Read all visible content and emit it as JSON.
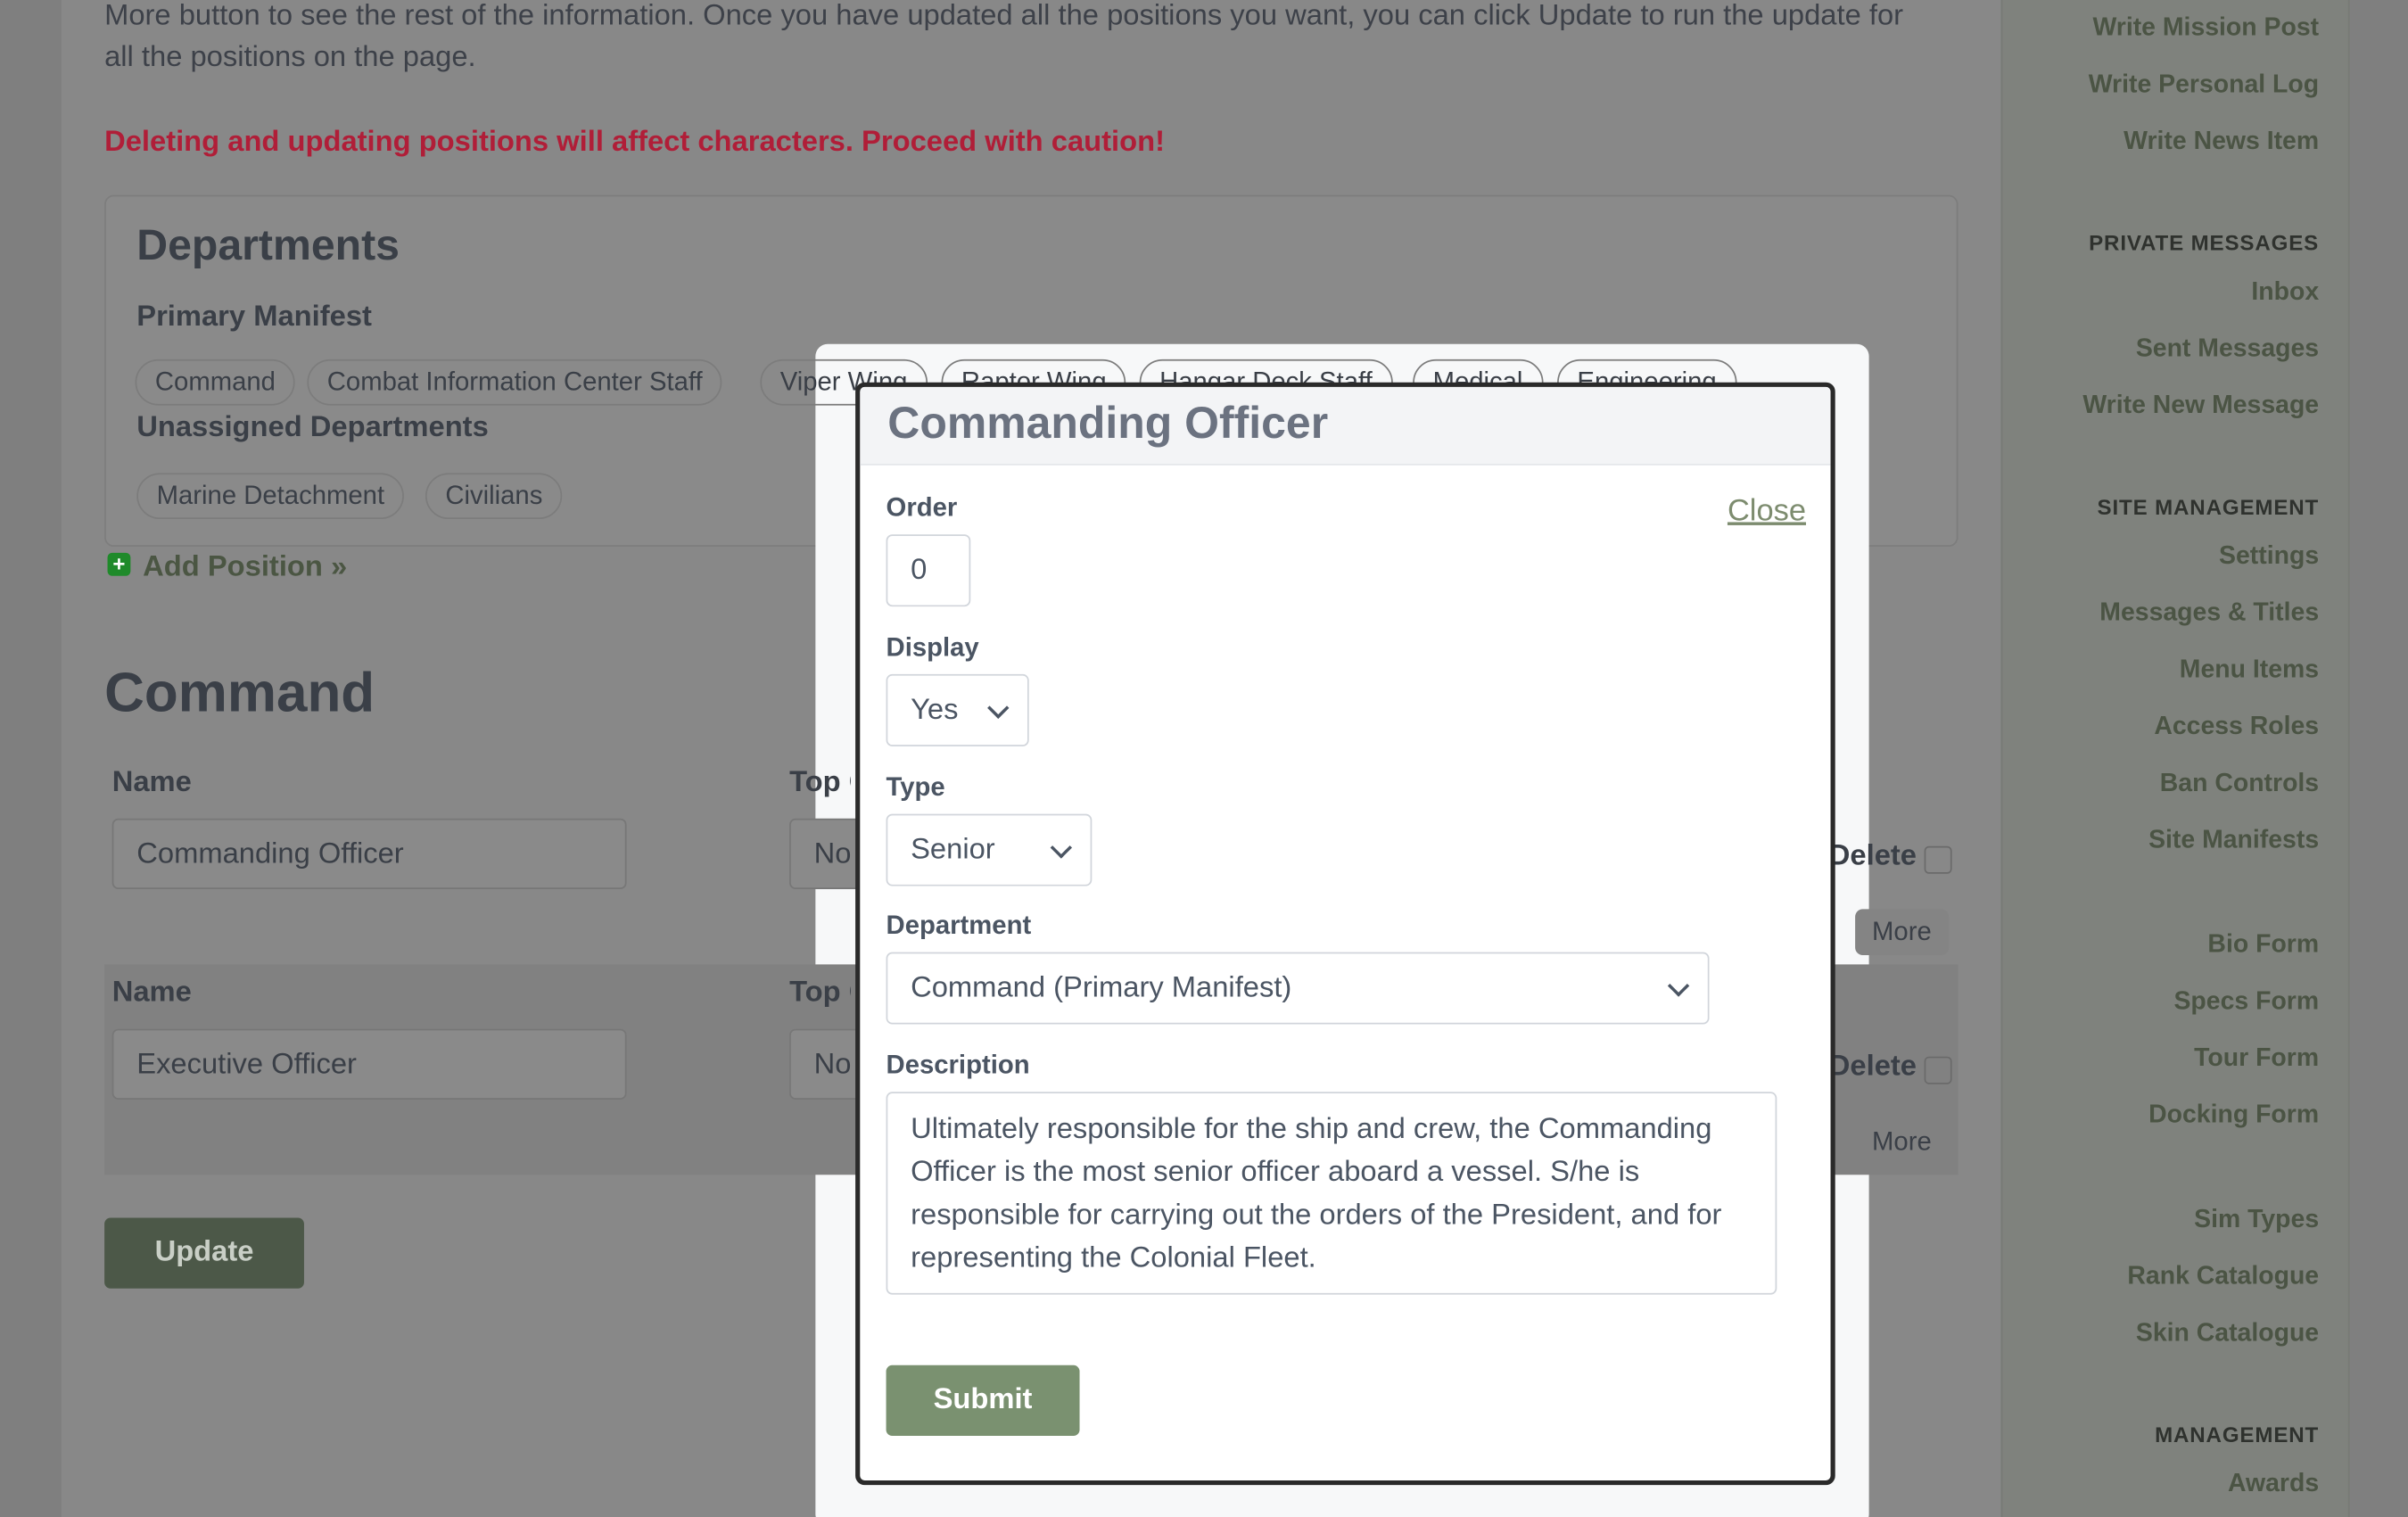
{
  "intro": "More button to see the rest of the information. Once you have updated all the positions you want, you can click Update to run the update for all the positions on the page.",
  "warning": "Deleting and updating positions will affect characters. Proceed with caution!",
  "departments": {
    "title": "Departments",
    "primary_label": "Primary Manifest",
    "primary": [
      "Command",
      "Combat Information Center Staff",
      "Viper Wing",
      "Raptor Wing",
      "Hangar Deck Staff",
      "Medical",
      "Engineering"
    ],
    "unassigned_label": "Unassigned Departments",
    "unassigned": [
      "Marine Detachment",
      "Civilians"
    ]
  },
  "add_position": "Add Position »",
  "section_title": "Command",
  "positions": [
    {
      "name_label": "Name",
      "name": "Commanding Officer",
      "top_label": "Top Open",
      "top_value": "No",
      "delete_label": "Delete?",
      "more": "More"
    },
    {
      "name_label": "Name",
      "name": "Executive Officer",
      "top_label": "Top Open",
      "top_value": "No",
      "delete_label": "Delete?",
      "more": "More"
    }
  ],
  "update_label": "Update",
  "sidebar": {
    "items": [
      {
        "type": "link",
        "label": "Write Mission Post"
      },
      {
        "type": "link",
        "label": "Write Personal Log"
      },
      {
        "type": "link",
        "label": "Write News Item"
      },
      {
        "type": "head",
        "label": "PRIVATE MESSAGES"
      },
      {
        "type": "link",
        "label": "Inbox"
      },
      {
        "type": "link",
        "label": "Sent Messages"
      },
      {
        "type": "link",
        "label": "Write New Message"
      },
      {
        "type": "head",
        "label": "SITE MANAGEMENT"
      },
      {
        "type": "link",
        "label": "Settings"
      },
      {
        "type": "link",
        "label": "Messages & Titles"
      },
      {
        "type": "link",
        "label": "Menu Items"
      },
      {
        "type": "link",
        "label": "Access Roles"
      },
      {
        "type": "link",
        "label": "Ban Controls"
      },
      {
        "type": "link",
        "label": "Site Manifests"
      },
      {
        "type": "link",
        "label": "Bio Form"
      },
      {
        "type": "link",
        "label": "Specs Form"
      },
      {
        "type": "link",
        "label": "Tour Form"
      },
      {
        "type": "link",
        "label": "Docking Form"
      },
      {
        "type": "link",
        "label": "Sim Types"
      },
      {
        "type": "link",
        "label": "Rank Catalogue"
      },
      {
        "type": "link",
        "label": "Skin Catalogue"
      },
      {
        "type": "head",
        "label": "MANAGEMENT"
      },
      {
        "type": "link",
        "label": "Awards"
      }
    ]
  },
  "modal": {
    "title": "Commanding Officer",
    "close": "Close",
    "order_label": "Order",
    "order": "0",
    "display_label": "Display",
    "display": "Yes",
    "type_label": "Type",
    "type": "Senior",
    "department_label": "Department",
    "department": "Command (Primary Manifest)",
    "description_label": "Description",
    "description": "Ultimately responsible for the ship and crew, the Commanding Officer is the most senior officer aboard a vessel. S/he is responsible for carrying out the orders of the President, and for representing the Colonial Fleet.",
    "submit": "Submit"
  },
  "colors": {
    "accent": "#7a9170",
    "warning": "#b01e38",
    "update_button": "#4c5848"
  }
}
